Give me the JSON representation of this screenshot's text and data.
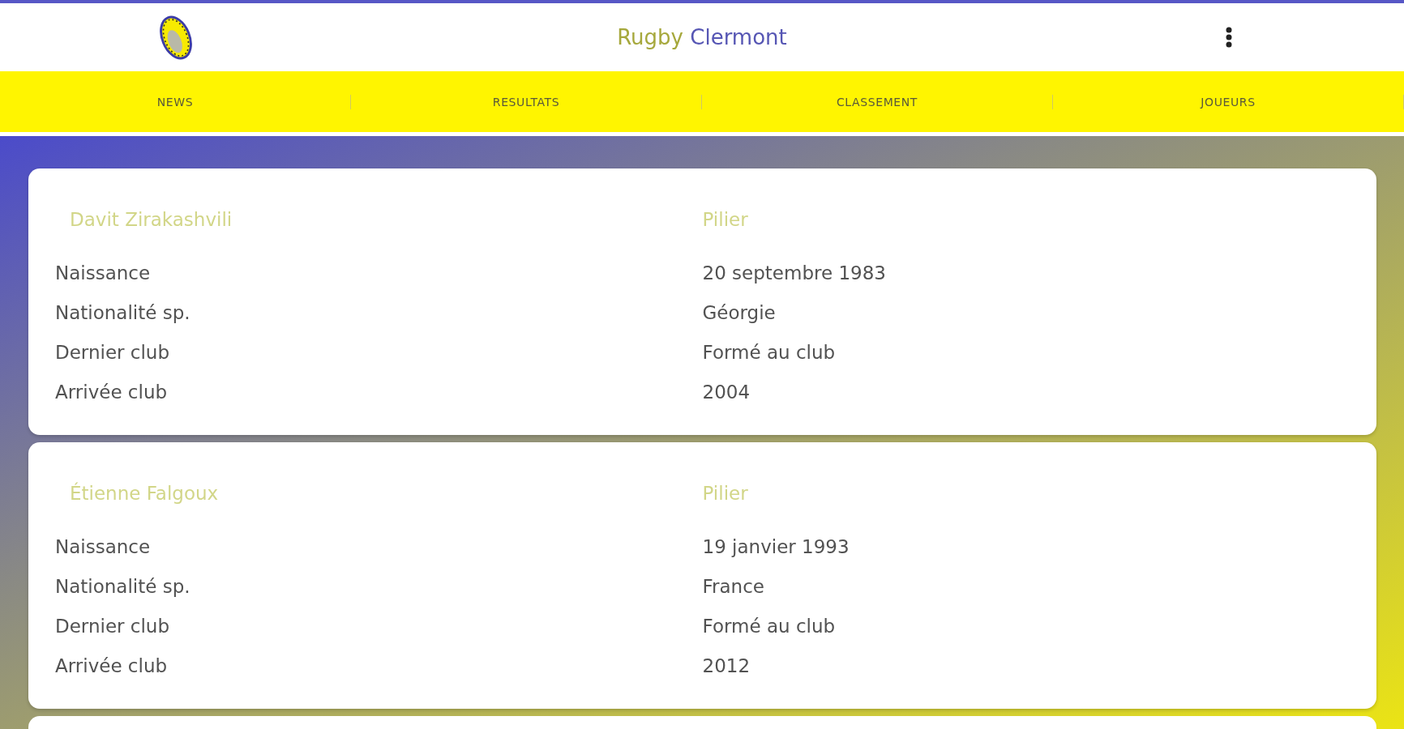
{
  "header": {
    "title": [
      {
        "text": "Rugby",
        "color": "#a6a83c"
      },
      {
        "text": "Clermont",
        "color": "#5656b4"
      }
    ]
  },
  "nav": {
    "tabs": [
      {
        "label": "NEWS",
        "selected": false
      },
      {
        "label": "RESULTATS",
        "selected": false
      },
      {
        "label": "CLASSEMENT",
        "selected": false
      },
      {
        "label": "JOUEURS",
        "selected": false
      }
    ]
  },
  "players": [
    {
      "name": "Davit Zirakashvili",
      "position": "Pilier",
      "details": [
        {
          "label": "Naissance",
          "value": "20 septembre 1983"
        },
        {
          "label": "Nationalité sp.",
          "value": "Géorgie"
        },
        {
          "label": "Dernier club",
          "value": "Formé au club"
        },
        {
          "label": "Arrivée club",
          "value": "2004"
        }
      ]
    },
    {
      "name": "Étienne Falgoux",
      "position": "Pilier",
      "details": [
        {
          "label": "Naissance",
          "value": "19 janvier 1993"
        },
        {
          "label": "Nationalité sp.",
          "value": "France"
        },
        {
          "label": "Dernier club",
          "value": "Formé au club"
        },
        {
          "label": "Arrivée club",
          "value": "2012"
        }
      ]
    }
  ]
}
